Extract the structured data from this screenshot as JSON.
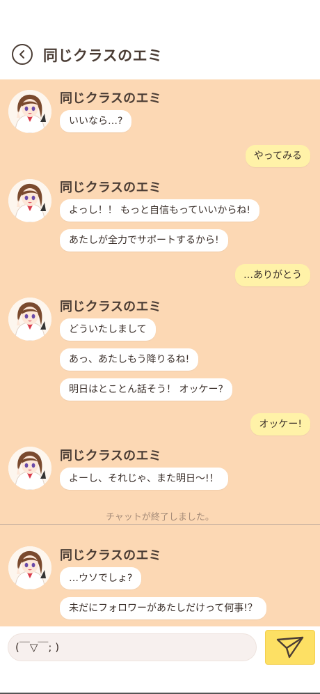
{
  "header": {
    "title": "同じクラスのエミ"
  },
  "sender_name": "同じクラスのエミ",
  "messages": [
    {
      "side": "left",
      "sender": "同じクラスのエミ",
      "lines": [
        "いいなら…?"
      ]
    },
    {
      "side": "right",
      "text": "やってみる"
    },
    {
      "side": "left",
      "sender": "同じクラスのエミ",
      "lines": [
        "よっし！！ もっと自信もっていいからね!",
        "あたしが全力でサポートするから!"
      ]
    },
    {
      "side": "right",
      "text": "…ありがとう"
    },
    {
      "side": "left",
      "sender": "同じクラスのエミ",
      "lines": [
        "どういたしまして",
        "あっ、あたしもう降りるね!",
        "明日はとことん話そう！ オッケー?"
      ]
    },
    {
      "side": "right",
      "text": "オッケー!"
    },
    {
      "side": "left",
      "sender": "同じクラスのエミ",
      "lines": [
        "よーし、それじゃ、また明日～!！"
      ]
    },
    {
      "side": "left",
      "sender": "同じクラスのエミ",
      "lines": [
        "…ウソでしょ?",
        "未だにフォロワーがあたしだけって何事!？"
      ]
    }
  ],
  "system": {
    "chat_ended": "チャットが終了しました。"
  },
  "input": {
    "value": "(￣▽￣; )"
  },
  "icons": {
    "back": "chevron-left-icon",
    "send": "paper-plane-icon"
  },
  "colors": {
    "chat_bg": "#fcd8b4",
    "reply_bubble": "#fff2a8",
    "send_button": "#fde064"
  }
}
